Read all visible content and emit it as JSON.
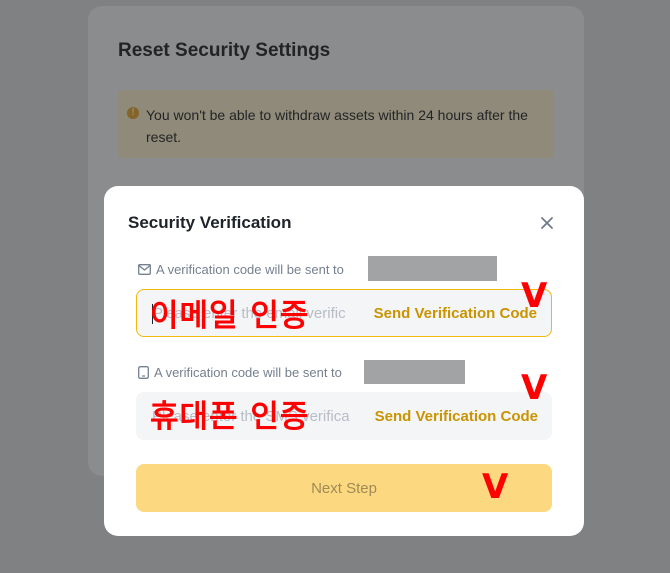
{
  "background": {
    "title": "Reset Security Settings",
    "warning": "You won't be able to withdraw assets within 24 hours after the reset.",
    "warning_icon": "!"
  },
  "modal": {
    "title": "Security Verification",
    "close_icon": "×",
    "email": {
      "hint": "A verification code will be sent to",
      "placeholder": "Please enter the email verific",
      "send_label": "Send Verification Code"
    },
    "phone": {
      "hint": "A verification code will be sent to",
      "placeholder": "Please enter the SMS verifica",
      "send_label": "Send Verification Code"
    },
    "next_label": "Next Step"
  },
  "annotations": {
    "email_label": "이메일 인증",
    "phone_label": "휴대폰 인증",
    "check_mark": "V"
  },
  "colors": {
    "accent": "#f0b90b",
    "link": "#c99400",
    "annotation": "#ff0000"
  }
}
